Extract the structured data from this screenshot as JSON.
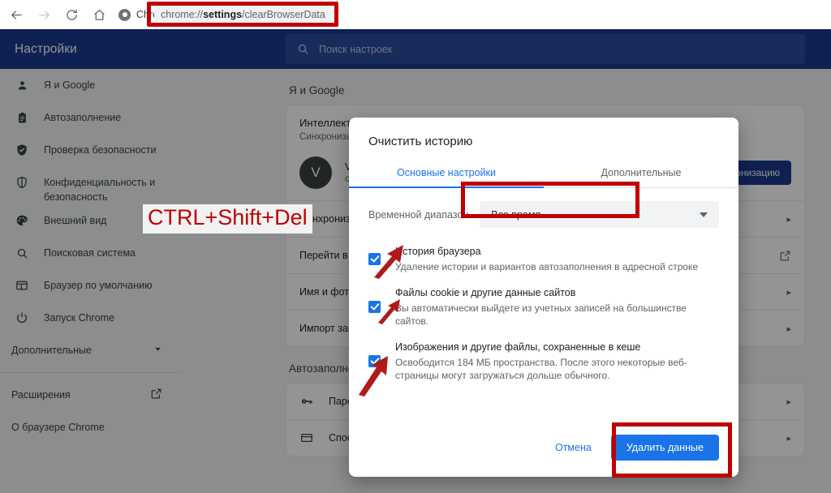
{
  "browser": {
    "nav": {
      "back_icon": "arrow-left-icon",
      "forward_icon": "arrow-right-icon",
      "reload_icon": "reload-icon",
      "home_icon": "home-icon"
    },
    "tab_label": "Chrome",
    "omnibox": {
      "scheme": "chrome://",
      "emphasis": "settings",
      "rest": "/clearBrowserData",
      "full_url": "chrome://settings/clearBrowserData"
    }
  },
  "settings": {
    "title": "Настройки",
    "search": {
      "placeholder": "Поиск настроек",
      "icon": "search-icon"
    },
    "sidebar": {
      "items": [
        {
          "label": "Я и Google",
          "icon": "person-icon"
        },
        {
          "label": "Автозаполнение",
          "icon": "clipboard-icon"
        },
        {
          "label": "Проверка безопасности",
          "icon": "shield-check-icon"
        },
        {
          "label": "Конфиденциальность и безопасность",
          "icon": "shield-icon"
        },
        {
          "label": "Внешний вид",
          "icon": "palette-icon"
        },
        {
          "label": "Поисковая система",
          "icon": "search-icon"
        },
        {
          "label": "Браузер по умолчанию",
          "icon": "browser-icon"
        },
        {
          "label": "Запуск Chrome",
          "icon": "power-icon"
        }
      ],
      "advanced": {
        "label": "Дополнительные",
        "icon": "chevron-down-icon"
      },
      "extensions": {
        "label": "Расширения",
        "icon": "external-link-icon"
      },
      "about": {
        "label": "О браузере Chrome"
      }
    },
    "main": {
      "section_title": "Я и Google",
      "sync_card": {
        "heading": "Интеллектуальные функции Google",
        "subheading": "Синхронизация и сервисы Google",
        "avatar_letter": "V",
        "profile_name": "V",
        "profile_email": "о",
        "sync_button": "Включить синхронизацию"
      },
      "rows": [
        {
          "label": "Синхронизация и сервисы Google",
          "trailing": "chevron-right-icon"
        },
        {
          "label": "Перейти в аккаунт Google",
          "trailing": "external-link-icon"
        },
        {
          "label": "Имя и фото в Chrome",
          "trailing": "chevron-right-icon"
        },
        {
          "label": "Импорт закладок и настроек",
          "trailing": "chevron-right-icon"
        }
      ],
      "autofill_title": "Автозаполнение",
      "autofill_rows": [
        {
          "label": "Пароли",
          "icon": "key-icon",
          "trailing": "chevron-right-icon"
        },
        {
          "label": "Способы оплаты",
          "icon": "credit-card-icon",
          "trailing": "chevron-right-icon"
        }
      ]
    }
  },
  "dialog": {
    "title": "Очистить историю",
    "tabs": [
      {
        "label": "Основные настройки",
        "active": true
      },
      {
        "label": "Дополнительные",
        "active": false
      }
    ],
    "range": {
      "label": "Временной диапазон",
      "value": "Все время",
      "caret_icon": "chevron-down-icon"
    },
    "options": [
      {
        "title": "История браузера",
        "desc": "Удаление истории и вариантов автозаполнения в адресной строке",
        "checked": true
      },
      {
        "title": "Файлы cookie и другие данные сайтов",
        "desc": "Вы автоматически выйдете из учетных записей на большинстве сайтов.",
        "checked": true
      },
      {
        "title": "Изображения и другие файлы, сохраненные в кеше",
        "desc": "Освободится 184 МБ пространства. После этого некоторые веб-страницы могут загружаться дольше обычного.",
        "checked": true
      }
    ],
    "cancel_label": "Отмена",
    "confirm_label": "Удалить данные"
  },
  "annotations": {
    "shortcut_text": "CTRL+Shift+Del",
    "shortcut_color": "#c00000",
    "highlight_color": "#c00000",
    "arrow_color": "#b01a1a",
    "arrow_icon": "arrow-up-right-icon"
  },
  "colors": {
    "settings_header": "#1a3a8f",
    "accent_blue": "#1a73e8",
    "annotation_red": "#c00000",
    "page_bg": "#f1f3f4"
  }
}
